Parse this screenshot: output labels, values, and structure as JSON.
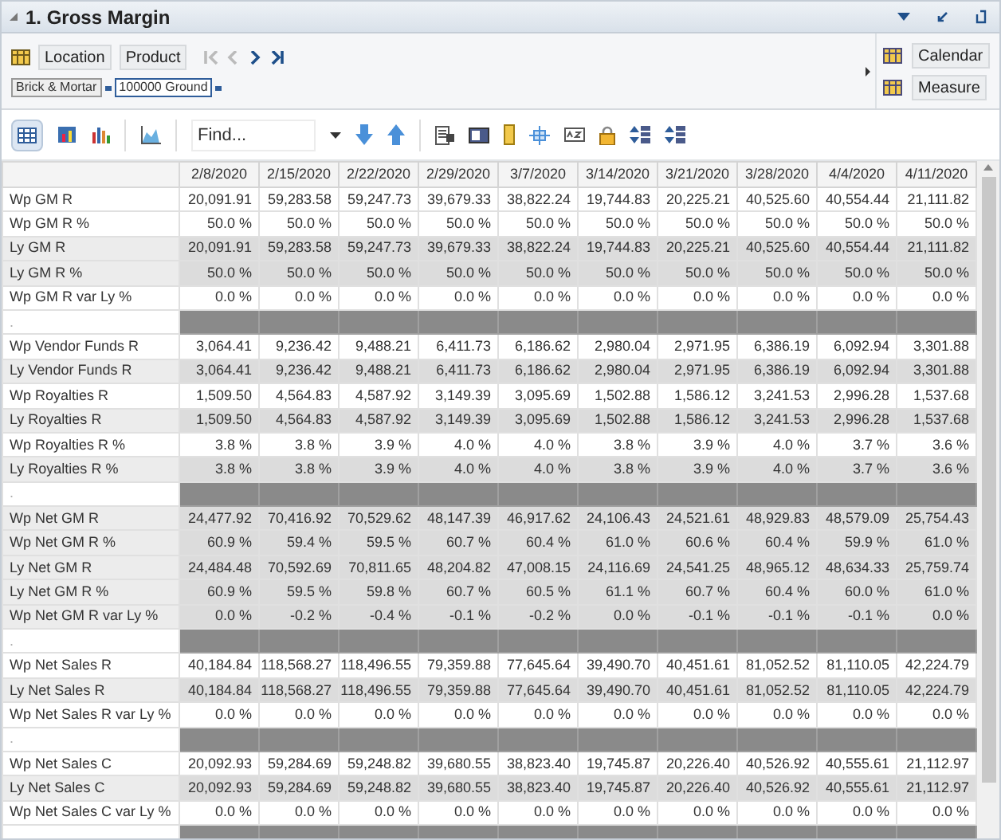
{
  "panel": {
    "title": "1. Gross Margin"
  },
  "dimensions": {
    "row": [
      "Location",
      "Product"
    ],
    "filters": [
      "Brick & Mortar",
      "100000 Ground"
    ],
    "columns": [
      "Calendar",
      "Measure"
    ]
  },
  "toolbar": {
    "find": {
      "placeholder": "Find..."
    }
  },
  "table": {
    "columns": [
      "2/8/2020",
      "2/15/2020",
      "2/22/2020",
      "2/29/2020",
      "3/7/2020",
      "3/14/2020",
      "3/21/2020",
      "3/28/2020",
      "4/4/2020",
      "4/11/2020"
    ],
    "rows": [
      {
        "kind": "data",
        "shaded": false,
        "label": "Wp GM R",
        "values": [
          "20,091.91",
          "59,283.58",
          "59,247.73",
          "39,679.33",
          "38,822.24",
          "19,744.83",
          "20,225.21",
          "40,525.60",
          "40,554.44",
          "21,111.82"
        ]
      },
      {
        "kind": "data",
        "shaded": false,
        "label": "Wp GM R %",
        "values": [
          "50.0 %",
          "50.0 %",
          "50.0 %",
          "50.0 %",
          "50.0 %",
          "50.0 %",
          "50.0 %",
          "50.0 %",
          "50.0 %",
          "50.0 %"
        ]
      },
      {
        "kind": "data",
        "shaded": true,
        "label": "Ly GM R",
        "values": [
          "20,091.91",
          "59,283.58",
          "59,247.73",
          "39,679.33",
          "38,822.24",
          "19,744.83",
          "20,225.21",
          "40,525.60",
          "40,554.44",
          "21,111.82"
        ]
      },
      {
        "kind": "data",
        "shaded": true,
        "label": "Ly GM R %",
        "values": [
          "50.0 %",
          "50.0 %",
          "50.0 %",
          "50.0 %",
          "50.0 %",
          "50.0 %",
          "50.0 %",
          "50.0 %",
          "50.0 %",
          "50.0 %"
        ]
      },
      {
        "kind": "data",
        "shaded": false,
        "label": "Wp GM R var Ly %",
        "values": [
          "0.0 %",
          "0.0 %",
          "0.0 %",
          "0.0 %",
          "0.0 %",
          "0.0 %",
          "0.0 %",
          "0.0 %",
          "0.0 %",
          "0.0 %"
        ]
      },
      {
        "kind": "separator",
        "label": "."
      },
      {
        "kind": "data",
        "shaded": false,
        "label": "Wp Vendor Funds R",
        "values": [
          "3,064.41",
          "9,236.42",
          "9,488.21",
          "6,411.73",
          "6,186.62",
          "2,980.04",
          "2,971.95",
          "6,386.19",
          "6,092.94",
          "3,301.88"
        ]
      },
      {
        "kind": "data",
        "shaded": true,
        "label": "Ly Vendor Funds R",
        "values": [
          "3,064.41",
          "9,236.42",
          "9,488.21",
          "6,411.73",
          "6,186.62",
          "2,980.04",
          "2,971.95",
          "6,386.19",
          "6,092.94",
          "3,301.88"
        ]
      },
      {
        "kind": "data",
        "shaded": false,
        "label": "Wp Royalties R",
        "values": [
          "1,509.50",
          "4,564.83",
          "4,587.92",
          "3,149.39",
          "3,095.69",
          "1,502.88",
          "1,586.12",
          "3,241.53",
          "2,996.28",
          "1,537.68"
        ]
      },
      {
        "kind": "data",
        "shaded": true,
        "label": "Ly Royalties R",
        "values": [
          "1,509.50",
          "4,564.83",
          "4,587.92",
          "3,149.39",
          "3,095.69",
          "1,502.88",
          "1,586.12",
          "3,241.53",
          "2,996.28",
          "1,537.68"
        ]
      },
      {
        "kind": "data",
        "shaded": false,
        "label": "Wp Royalties R %",
        "values": [
          "3.8 %",
          "3.8 %",
          "3.9 %",
          "4.0 %",
          "4.0 %",
          "3.8 %",
          "3.9 %",
          "4.0 %",
          "3.7 %",
          "3.6 %"
        ]
      },
      {
        "kind": "data",
        "shaded": true,
        "label": "Ly Royalties R %",
        "values": [
          "3.8 %",
          "3.8 %",
          "3.9 %",
          "4.0 %",
          "4.0 %",
          "3.8 %",
          "3.9 %",
          "4.0 %",
          "3.7 %",
          "3.6 %"
        ]
      },
      {
        "kind": "separator",
        "label": "."
      },
      {
        "kind": "data",
        "shaded": true,
        "label": "Wp Net GM R",
        "values": [
          "24,477.92",
          "70,416.92",
          "70,529.62",
          "48,147.39",
          "46,917.62",
          "24,106.43",
          "24,521.61",
          "48,929.83",
          "48,579.09",
          "25,754.43"
        ]
      },
      {
        "kind": "data",
        "shaded": true,
        "label": "Wp Net GM R %",
        "values": [
          "60.9 %",
          "59.4 %",
          "59.5 %",
          "60.7 %",
          "60.4 %",
          "61.0 %",
          "60.6 %",
          "60.4 %",
          "59.9 %",
          "61.0 %"
        ]
      },
      {
        "kind": "data",
        "shaded": true,
        "label": "Ly Net GM R",
        "values": [
          "24,484.48",
          "70,592.69",
          "70,811.65",
          "48,204.82",
          "47,008.15",
          "24,116.69",
          "24,541.25",
          "48,965.12",
          "48,634.33",
          "25,759.74"
        ]
      },
      {
        "kind": "data",
        "shaded": true,
        "label": "Ly Net GM R %",
        "values": [
          "60.9 %",
          "59.5 %",
          "59.8 %",
          "60.7 %",
          "60.5 %",
          "61.1 %",
          "60.7 %",
          "60.4 %",
          "60.0 %",
          "61.0 %"
        ]
      },
      {
        "kind": "data",
        "shaded": true,
        "label": "Wp Net GM R var Ly %",
        "values": [
          "0.0 %",
          "-0.2 %",
          "-0.4 %",
          "-0.1 %",
          "-0.2 %",
          "0.0 %",
          "-0.1 %",
          "-0.1 %",
          "-0.1 %",
          "0.0 %"
        ]
      },
      {
        "kind": "separator",
        "label": "."
      },
      {
        "kind": "data",
        "shaded": false,
        "label": "Wp Net Sales R",
        "values": [
          "40,184.84",
          "118,568.27",
          "118,496.55",
          "79,359.88",
          "77,645.64",
          "39,490.70",
          "40,451.61",
          "81,052.52",
          "81,110.05",
          "42,224.79"
        ]
      },
      {
        "kind": "data",
        "shaded": true,
        "label": "Ly Net Sales R",
        "values": [
          "40,184.84",
          "118,568.27",
          "118,496.55",
          "79,359.88",
          "77,645.64",
          "39,490.70",
          "40,451.61",
          "81,052.52",
          "81,110.05",
          "42,224.79"
        ]
      },
      {
        "kind": "data",
        "shaded": false,
        "label": "Wp Net Sales R var Ly %",
        "values": [
          "0.0 %",
          "0.0 %",
          "0.0 %",
          "0.0 %",
          "0.0 %",
          "0.0 %",
          "0.0 %",
          "0.0 %",
          "0.0 %",
          "0.0 %"
        ]
      },
      {
        "kind": "separator",
        "label": "."
      },
      {
        "kind": "data",
        "shaded": false,
        "label": "Wp Net Sales C",
        "values": [
          "20,092.93",
          "59,284.69",
          "59,248.82",
          "39,680.55",
          "38,823.40",
          "19,745.87",
          "20,226.40",
          "40,526.92",
          "40,555.61",
          "21,112.97"
        ]
      },
      {
        "kind": "data",
        "shaded": true,
        "label": "Ly Net Sales C",
        "values": [
          "20,092.93",
          "59,284.69",
          "59,248.82",
          "39,680.55",
          "38,823.40",
          "19,745.87",
          "20,226.40",
          "40,526.92",
          "40,555.61",
          "21,112.97"
        ]
      },
      {
        "kind": "data",
        "shaded": false,
        "label": "Wp Net Sales C var Ly %",
        "values": [
          "0.0 %",
          "0.0 %",
          "0.0 %",
          "0.0 %",
          "0.0 %",
          "0.0 %",
          "0.0 %",
          "0.0 %",
          "0.0 %",
          "0.0 %"
        ]
      },
      {
        "kind": "separator"
      }
    ]
  }
}
